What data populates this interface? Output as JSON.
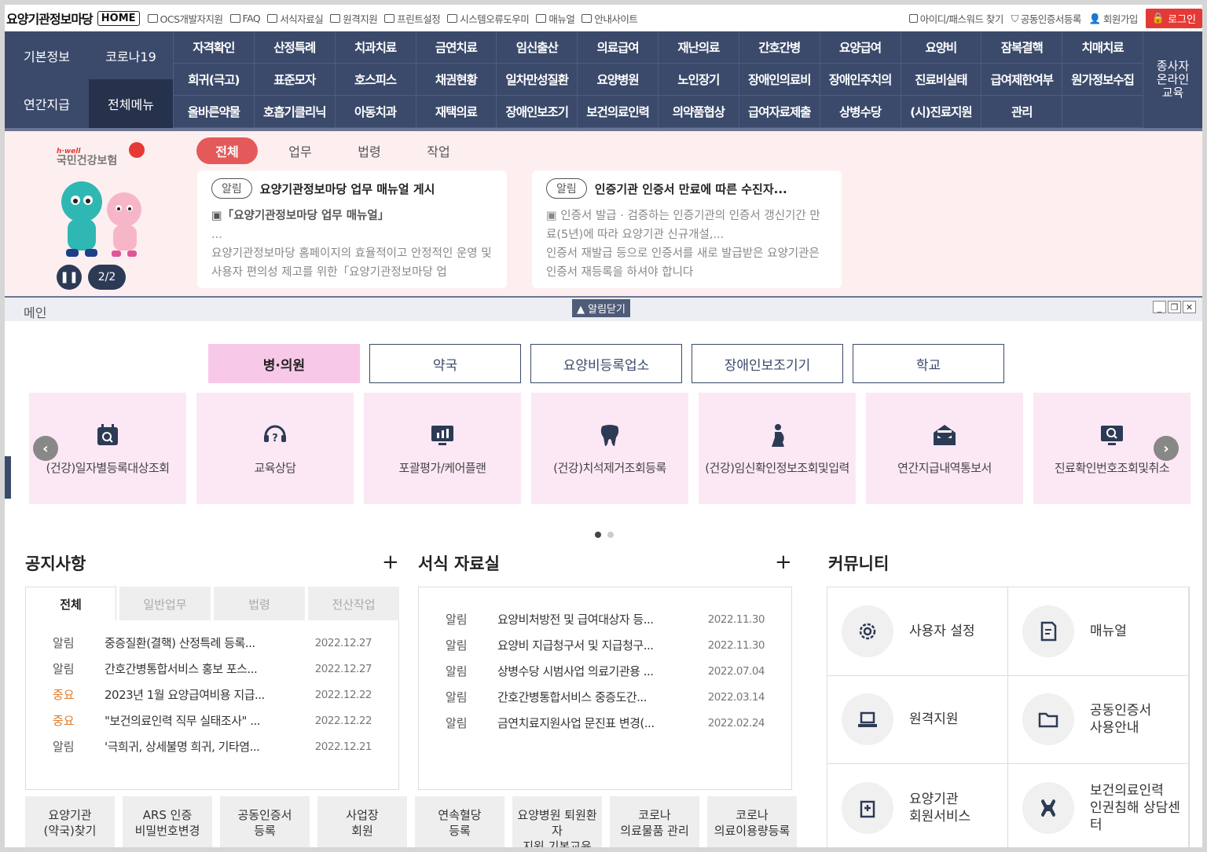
{
  "topbar": {
    "site_title": "요양기관정보마당",
    "home": "HOME",
    "links": [
      "OCS개발자지원",
      "FAQ",
      "서식자료실",
      "원격지원",
      "프린트설정",
      "시스템오류도우미",
      "매뉴얼",
      "안내사이트"
    ],
    "right_links": [
      "아이디/패스워드 찾기",
      "공동인증서등록",
      "회원가입"
    ],
    "login": "로그인"
  },
  "nav": {
    "left": [
      "기본정보",
      "코로나19",
      "연간지급",
      "전체메뉴"
    ],
    "items": [
      "자격확인",
      "산정특례",
      "치과치료",
      "금연치료",
      "임신출산",
      "의료급여",
      "재난의료",
      "간호간병",
      "요양급여",
      "요양비",
      "잠복결핵",
      "치매치료",
      "희귀(극고)",
      "표준모자",
      "호스피스",
      "채권현황",
      "일차만성질환",
      "요양병원",
      "노인장기",
      "장애인의료비",
      "장애인주치의",
      "진료비실태",
      "급여제한여부",
      "원가정보수집",
      "올바른약물",
      "호흡기클리닉",
      "아동치과",
      "재택의료",
      "장애인보조기",
      "보건의료인력",
      "의약품협상",
      "급여자료제출",
      "상병수당",
      "(시)진료지원",
      "관리",
      ""
    ],
    "edu": "종사자 온라인 교육"
  },
  "banner": {
    "logo_sub": "h·well",
    "logo": "국민건강보험",
    "pager": "2/2",
    "tabs": [
      "전체",
      "업무",
      "법령",
      "작업"
    ],
    "cards": [
      {
        "tag": "알림",
        "title": "요양기관정보마당 업무 매뉴얼 게시",
        "body1": "▣「요양기관정보마당 업무 매뉴얼」",
        "body2": "...",
        "body3": "요양기관정보마당 홈페이지의 효율적이고 안정적인 운영 및 사용자 편의성 제고를 위한「요양기관정보마당 업"
      },
      {
        "tag": "알림",
        "title": "인증기관 인증서 만료에 따른 수진자...",
        "body1": "▣ 인증서 발급 · 검증하는 인증기관의 인증서 갱신기간 만료(5년)에 따라 요양기관 신규개설,...",
        "body2": "",
        "body3": "인증서 재발급 등으로 인증서를 새로 발급받은 요양기관은 인증서 재등록을 하셔야 합니다"
      }
    ]
  },
  "window": {
    "title": "메인",
    "alarm_close": "▲ 알림닫기"
  },
  "categories": [
    "병·의원",
    "약국",
    "요양비등록업소",
    "장애인보조기기",
    "학교"
  ],
  "services": [
    {
      "label": "(건강)일자별등록대상조회",
      "icon": "calendar-search-icon"
    },
    {
      "label": "교육상담",
      "icon": "headset-question-icon"
    },
    {
      "label": "포괄평가/케어플랜",
      "icon": "monitor-chart-icon"
    },
    {
      "label": "(건강)치석제거조회등록",
      "icon": "tooth-icon"
    },
    {
      "label": "(건강)임신확인정보조회및입력",
      "icon": "pregnant-icon"
    },
    {
      "label": "연간지급내역통보서",
      "icon": "mail-open-icon"
    },
    {
      "label": "진료확인번호조회및취소",
      "icon": "monitor-search-icon"
    }
  ],
  "notices": {
    "title": "공지사항",
    "tabs": [
      "전체",
      "일반업무",
      "법령",
      "전산작업"
    ],
    "rows": [
      {
        "tag": "알림",
        "important": false,
        "text": "중증질환(결핵) 산정특례 등록...",
        "date": "2022.12.27"
      },
      {
        "tag": "알림",
        "important": false,
        "text": "간호간병통합서비스 홍보 포스...",
        "date": "2022.12.27"
      },
      {
        "tag": "중요",
        "important": true,
        "text": "2023년 1월 요양급여비용 지급...",
        "date": "2022.12.22"
      },
      {
        "tag": "중요",
        "important": true,
        "text": "\"보건의료인력 직무 실태조사\" ...",
        "date": "2022.12.22"
      },
      {
        "tag": "알림",
        "important": false,
        "text": "'극희귀, 상세불명 희귀, 기타염...",
        "date": "2022.12.21"
      }
    ]
  },
  "forms": {
    "title": "서식 자료실",
    "rows": [
      {
        "tag": "알림",
        "text": "요양비처방전 및 급여대상자 등...",
        "date": "2022.11.30"
      },
      {
        "tag": "알림",
        "text": "요양비 지급청구서 및 지급청구...",
        "date": "2022.11.30"
      },
      {
        "tag": "알림",
        "text": "상병수당 시범사업 의료기관용 ...",
        "date": "2022.07.04"
      },
      {
        "tag": "알림",
        "text": "간호간병통합서비스 중증도간...",
        "date": "2022.03.14"
      },
      {
        "tag": "알림",
        "text": "금연치료지원사업 문진표 변경(...",
        "date": "2022.02.24"
      }
    ]
  },
  "quicklinks": [
    [
      "요양기관",
      "(약국)찾기"
    ],
    [
      "ARS 인증",
      "비밀번호변경"
    ],
    [
      "공동인증서",
      "등록"
    ],
    [
      "사업장",
      "회원"
    ],
    [
      "연속혈당",
      "등록"
    ],
    [
      "요양병원 퇴원환",
      "자",
      "지원 기본교육"
    ],
    [
      "코로나",
      "의료물품 관리"
    ],
    [
      "코로나",
      "의료이용량등록"
    ]
  ],
  "community": {
    "title": "커뮤니티",
    "items": [
      {
        "label": [
          "사용자 설정"
        ],
        "icon": "gear-icon"
      },
      {
        "label": [
          "매뉴얼"
        ],
        "icon": "document-icon"
      },
      {
        "label": [
          "원격지원"
        ],
        "icon": "laptop-icon"
      },
      {
        "label": [
          "공동인증서",
          "사용안내"
        ],
        "icon": "folder-icon"
      },
      {
        "label": [
          "요양기관",
          "회원서비스"
        ],
        "icon": "hospital-icon"
      },
      {
        "label": [
          "보건의료인력",
          "인권침해 상담센",
          "터"
        ],
        "icon": "hands-icon"
      }
    ]
  }
}
